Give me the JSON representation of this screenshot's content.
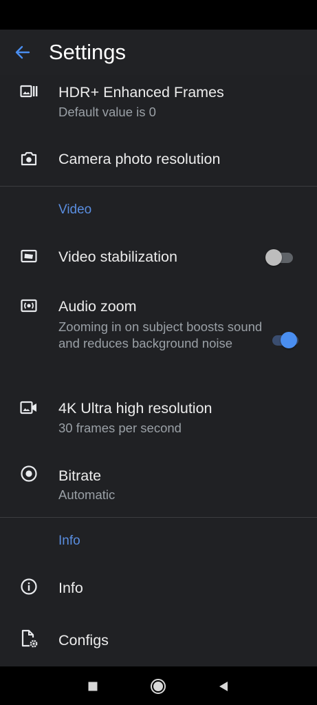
{
  "app_bar": {
    "title": "Settings",
    "back_icon": "arrow-back-icon",
    "accent": "#4a8ef0"
  },
  "rows": {
    "hdr": {
      "title": "HDR+ Enhanced Frames",
      "summary": "Default value is 0",
      "icon": "burst-frames-icon"
    },
    "photo_resolution": {
      "title": "Camera photo resolution",
      "icon": "camera-icon"
    },
    "video_stabilization": {
      "title": "Video stabilization",
      "icon": "stabilization-icon",
      "enabled": false
    },
    "audio_zoom": {
      "title": "Audio zoom",
      "summary": "Zooming in on subject boosts sound and reduces background noise",
      "icon": "audio-zoom-icon",
      "enabled": true
    },
    "ultra_hd": {
      "title": "4K Ultra high resolution",
      "summary": "30 frames per second",
      "icon": "video-camera-icon"
    },
    "bitrate": {
      "title": "Bitrate",
      "summary": "Automatic",
      "icon": "radio-button-icon"
    },
    "info": {
      "title": "Info",
      "icon": "info-icon"
    },
    "configs": {
      "title": "Configs",
      "icon": "file-settings-icon"
    }
  },
  "sections": {
    "video": "Video",
    "info": "Info"
  },
  "nav_bar": {
    "icons": [
      "recents-square-icon",
      "home-circle-icon",
      "back-triangle-icon"
    ]
  }
}
